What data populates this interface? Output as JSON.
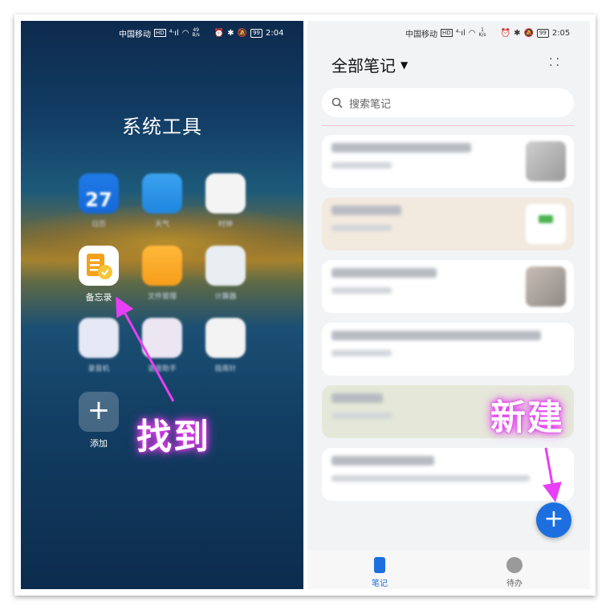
{
  "left": {
    "status": {
      "carrier": "中国移动",
      "speed_top": "49",
      "speed_bottom": "B/s",
      "battery": "99",
      "time": "2:04"
    },
    "folder_title": "系统工具",
    "apps": [
      {
        "label": "日历",
        "icon": "calendar-icon",
        "day": "27"
      },
      {
        "label": "天气",
        "icon": "weather-icon"
      },
      {
        "label": "时钟",
        "icon": "clock-icon"
      },
      {
        "label": "备忘录",
        "icon": "notes-icon"
      },
      {
        "label": "文件管理",
        "icon": "folder-icon"
      },
      {
        "label": "计算器",
        "icon": "calculator-icon"
      },
      {
        "label": "录音机",
        "icon": "recorder-icon"
      },
      {
        "label": "语音助手",
        "icon": "voice-icon"
      },
      {
        "label": "指南针",
        "icon": "compass-icon"
      },
      {
        "label": "添加",
        "icon": "plus-icon"
      }
    ],
    "annotation": "找到"
  },
  "right": {
    "status": {
      "carrier": "中国移动",
      "speed_top": "1",
      "speed_bottom": "K/s",
      "battery": "99",
      "time": "2:05"
    },
    "title": "全部笔记",
    "search_placeholder": "搜索笔记",
    "annotation": "新建",
    "tabs": [
      {
        "label": "笔记",
        "icon": "note-icon",
        "active": true
      },
      {
        "label": "待办",
        "icon": "todo-icon",
        "active": false
      }
    ]
  },
  "colors": {
    "accent": "#1d6fe0",
    "annotation_glow": "#e83ef5",
    "arrow": "#e83ef5"
  }
}
